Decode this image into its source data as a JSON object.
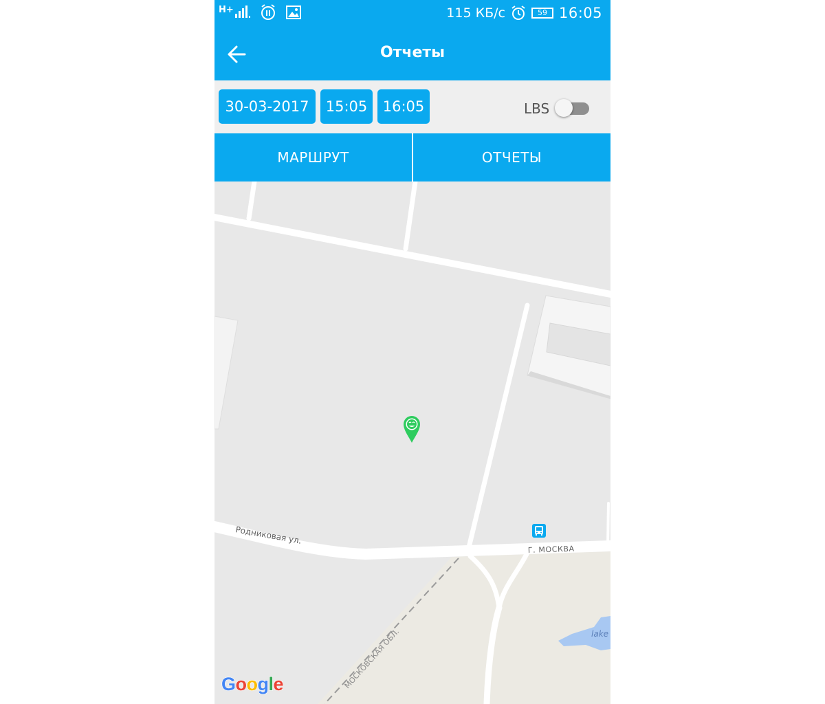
{
  "status_bar": {
    "network": "H+",
    "speed": "115 КБ/с",
    "battery": "59",
    "time": "16:05"
  },
  "app_bar": {
    "title": "Отчеты"
  },
  "filters": {
    "date": "30-03-2017",
    "time_from": "15:05",
    "time_to": "16:05",
    "lbs_label": "LBS",
    "lbs_enabled": false
  },
  "tabs": [
    {
      "label": "МАРШРУТ"
    },
    {
      "label": "ОТЧЕТЫ"
    }
  ],
  "map": {
    "street_label": "Родниковая ул.",
    "city_label": "г. Москва",
    "region_label": "МОСКОВСКАЯ ОБЛ.",
    "lake_label": "lake",
    "marker_icon": "smiley-location-pin-icon",
    "marker_color": "#2ecc5e",
    "bus_stop_icon": "bus-icon",
    "provider": "Google"
  },
  "colors": {
    "accent": "#0aa9ef"
  }
}
